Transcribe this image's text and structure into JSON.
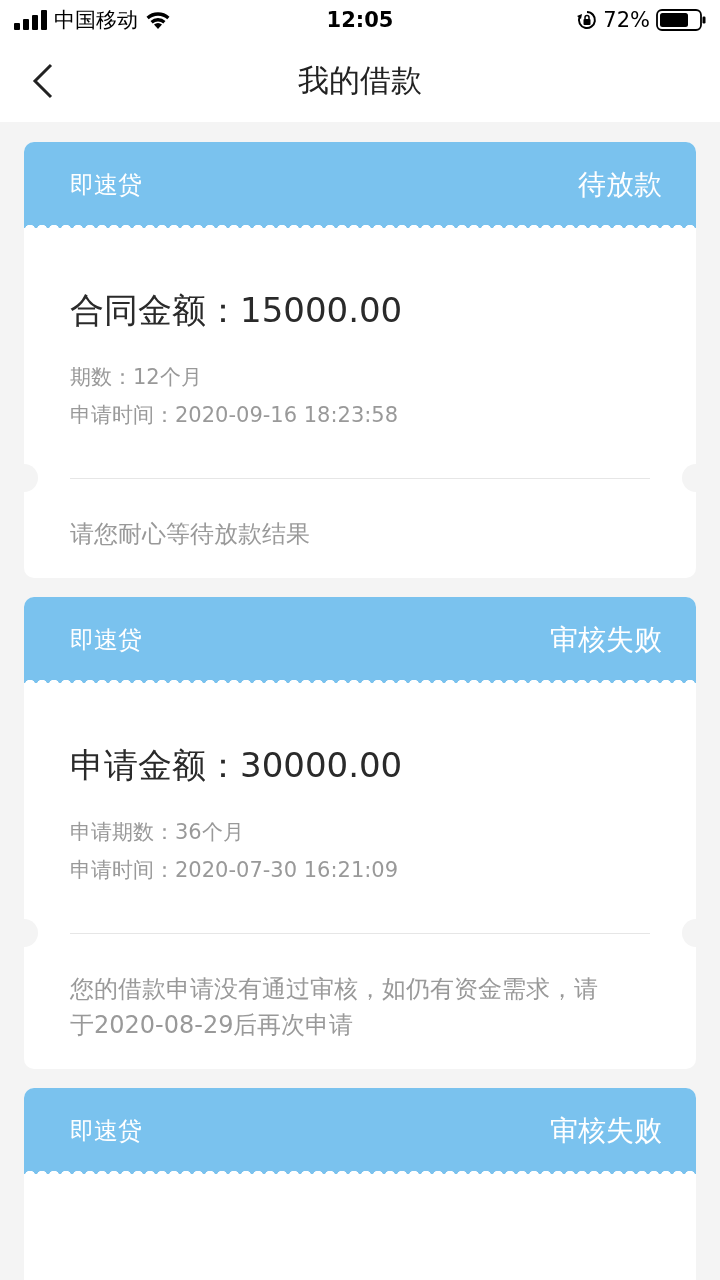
{
  "status_bar": {
    "carrier": "中国移动",
    "time": "12:05",
    "battery_percent": "72%"
  },
  "nav": {
    "title": "我的借款"
  },
  "loans": [
    {
      "product": "即速贷",
      "status": "待放款",
      "amount_label": "合同金额：",
      "amount": "15000.00",
      "details": [
        {
          "label": "期数：",
          "value": "12个月"
        },
        {
          "label": "申请时间：",
          "value": "2020-09-16 18:23:58"
        }
      ],
      "message": "请您耐心等待放款结果"
    },
    {
      "product": "即速贷",
      "status": "审核失败",
      "amount_label": "申请金额：",
      "amount": "30000.00",
      "details": [
        {
          "label": "申请期数：",
          "value": "36个月"
        },
        {
          "label": "申请时间：",
          "value": "2020-07-30 16:21:09"
        }
      ],
      "message": "您的借款申请没有通过审核，如仍有资金需求，请于2020-08-29后再次申请"
    },
    {
      "product": "即速贷",
      "status": "审核失败"
    }
  ]
}
